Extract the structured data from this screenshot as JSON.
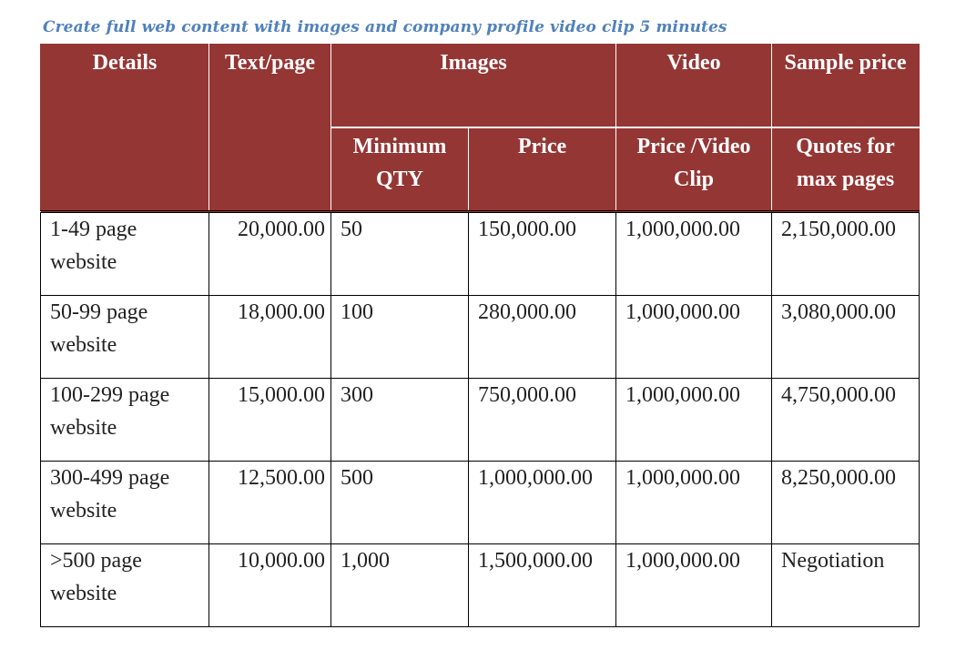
{
  "caption": "Create full web content with images and company profile video clip 5 minutes",
  "header": {
    "details": "Details",
    "text_page": "Text/page",
    "images": "Images",
    "video": "Video",
    "sample_price": "Sample price",
    "min_qty": "Minimum QTY",
    "price": "Price",
    "price_video": "Price /Video Clip",
    "quotes": "Quotes for max pages"
  },
  "rows": [
    {
      "details": "1-49 page website",
      "text_page": "20,000.00",
      "min_qty": "50",
      "price": "150,000.00",
      "video": "1,000,000.00",
      "sample": "2,150,000.00"
    },
    {
      "details": "50-99 page website",
      "text_page": "18,000.00",
      "min_qty": "100",
      "price": "280,000.00",
      "video": "1,000,000.00",
      "sample": "3,080,000.00"
    },
    {
      "details": "100-299 page website",
      "text_page": "15,000.00",
      "min_qty": "300",
      "price": "750,000.00",
      "video": "1,000,000.00",
      "sample": "4,750,000.00"
    },
    {
      "details": "300-499 page website",
      "text_page": "12,500.00",
      "min_qty": "500",
      "price": "1,000,000.00",
      "video": "1,000,000.00",
      "sample": "8,250,000.00"
    },
    {
      "details": ">500 page website",
      "text_page": "10,000.00",
      "min_qty": "1,000",
      "price": "1,500,000.00",
      "video": "1,000,000.00",
      "sample": "Negotiation"
    }
  ],
  "colors": {
    "header_bg": "#943634",
    "caption": "#4f81bd"
  }
}
